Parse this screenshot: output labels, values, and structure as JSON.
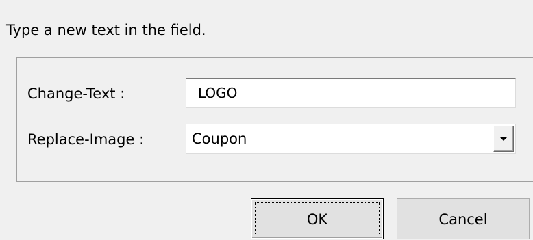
{
  "dialog": {
    "instruction": "Type a new text in the field.",
    "fields": {
      "change_text": {
        "label": "Change-Text :",
        "value": "LOGO"
      },
      "replace_image": {
        "label": "Replace-Image :",
        "selected": "Coupon"
      }
    },
    "buttons": {
      "ok": "OK",
      "cancel": "Cancel"
    }
  },
  "icons": {
    "dropdown": "chevron-down-icon"
  },
  "colors": {
    "background": "#f0f0f0",
    "button_face": "#e1e1e1",
    "field_background": "#ffffff"
  }
}
